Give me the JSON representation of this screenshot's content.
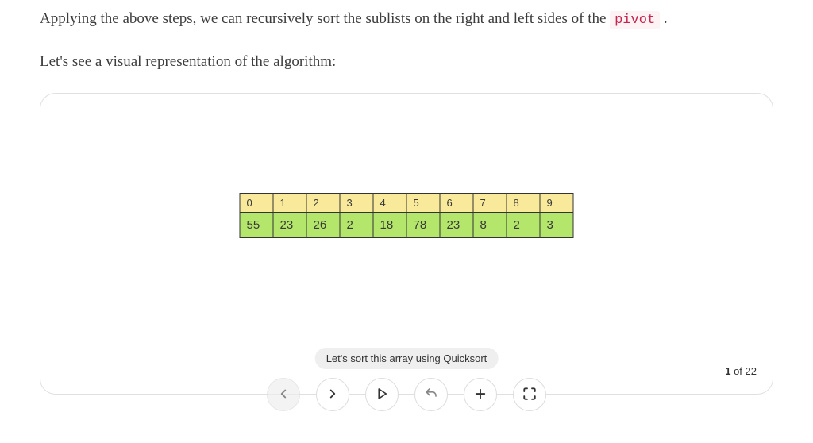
{
  "paragraphs": {
    "p1_a": "Applying the above steps, we can recursively sort the sublists on the right and left sides of the ",
    "p1_code": "pivot",
    "p1_b": " .",
    "p2": "Let's see a visual representation of the algorithm:"
  },
  "array": {
    "indices": [
      "0",
      "1",
      "2",
      "3",
      "4",
      "5",
      "6",
      "7",
      "8",
      "9"
    ],
    "values": [
      "55",
      "23",
      "26",
      "2",
      "18",
      "78",
      "23",
      "8",
      "2",
      "3"
    ]
  },
  "caption": "Let's sort this array using Quicksort",
  "pager": {
    "current": "1",
    "of_text": " of ",
    "total": "22"
  }
}
